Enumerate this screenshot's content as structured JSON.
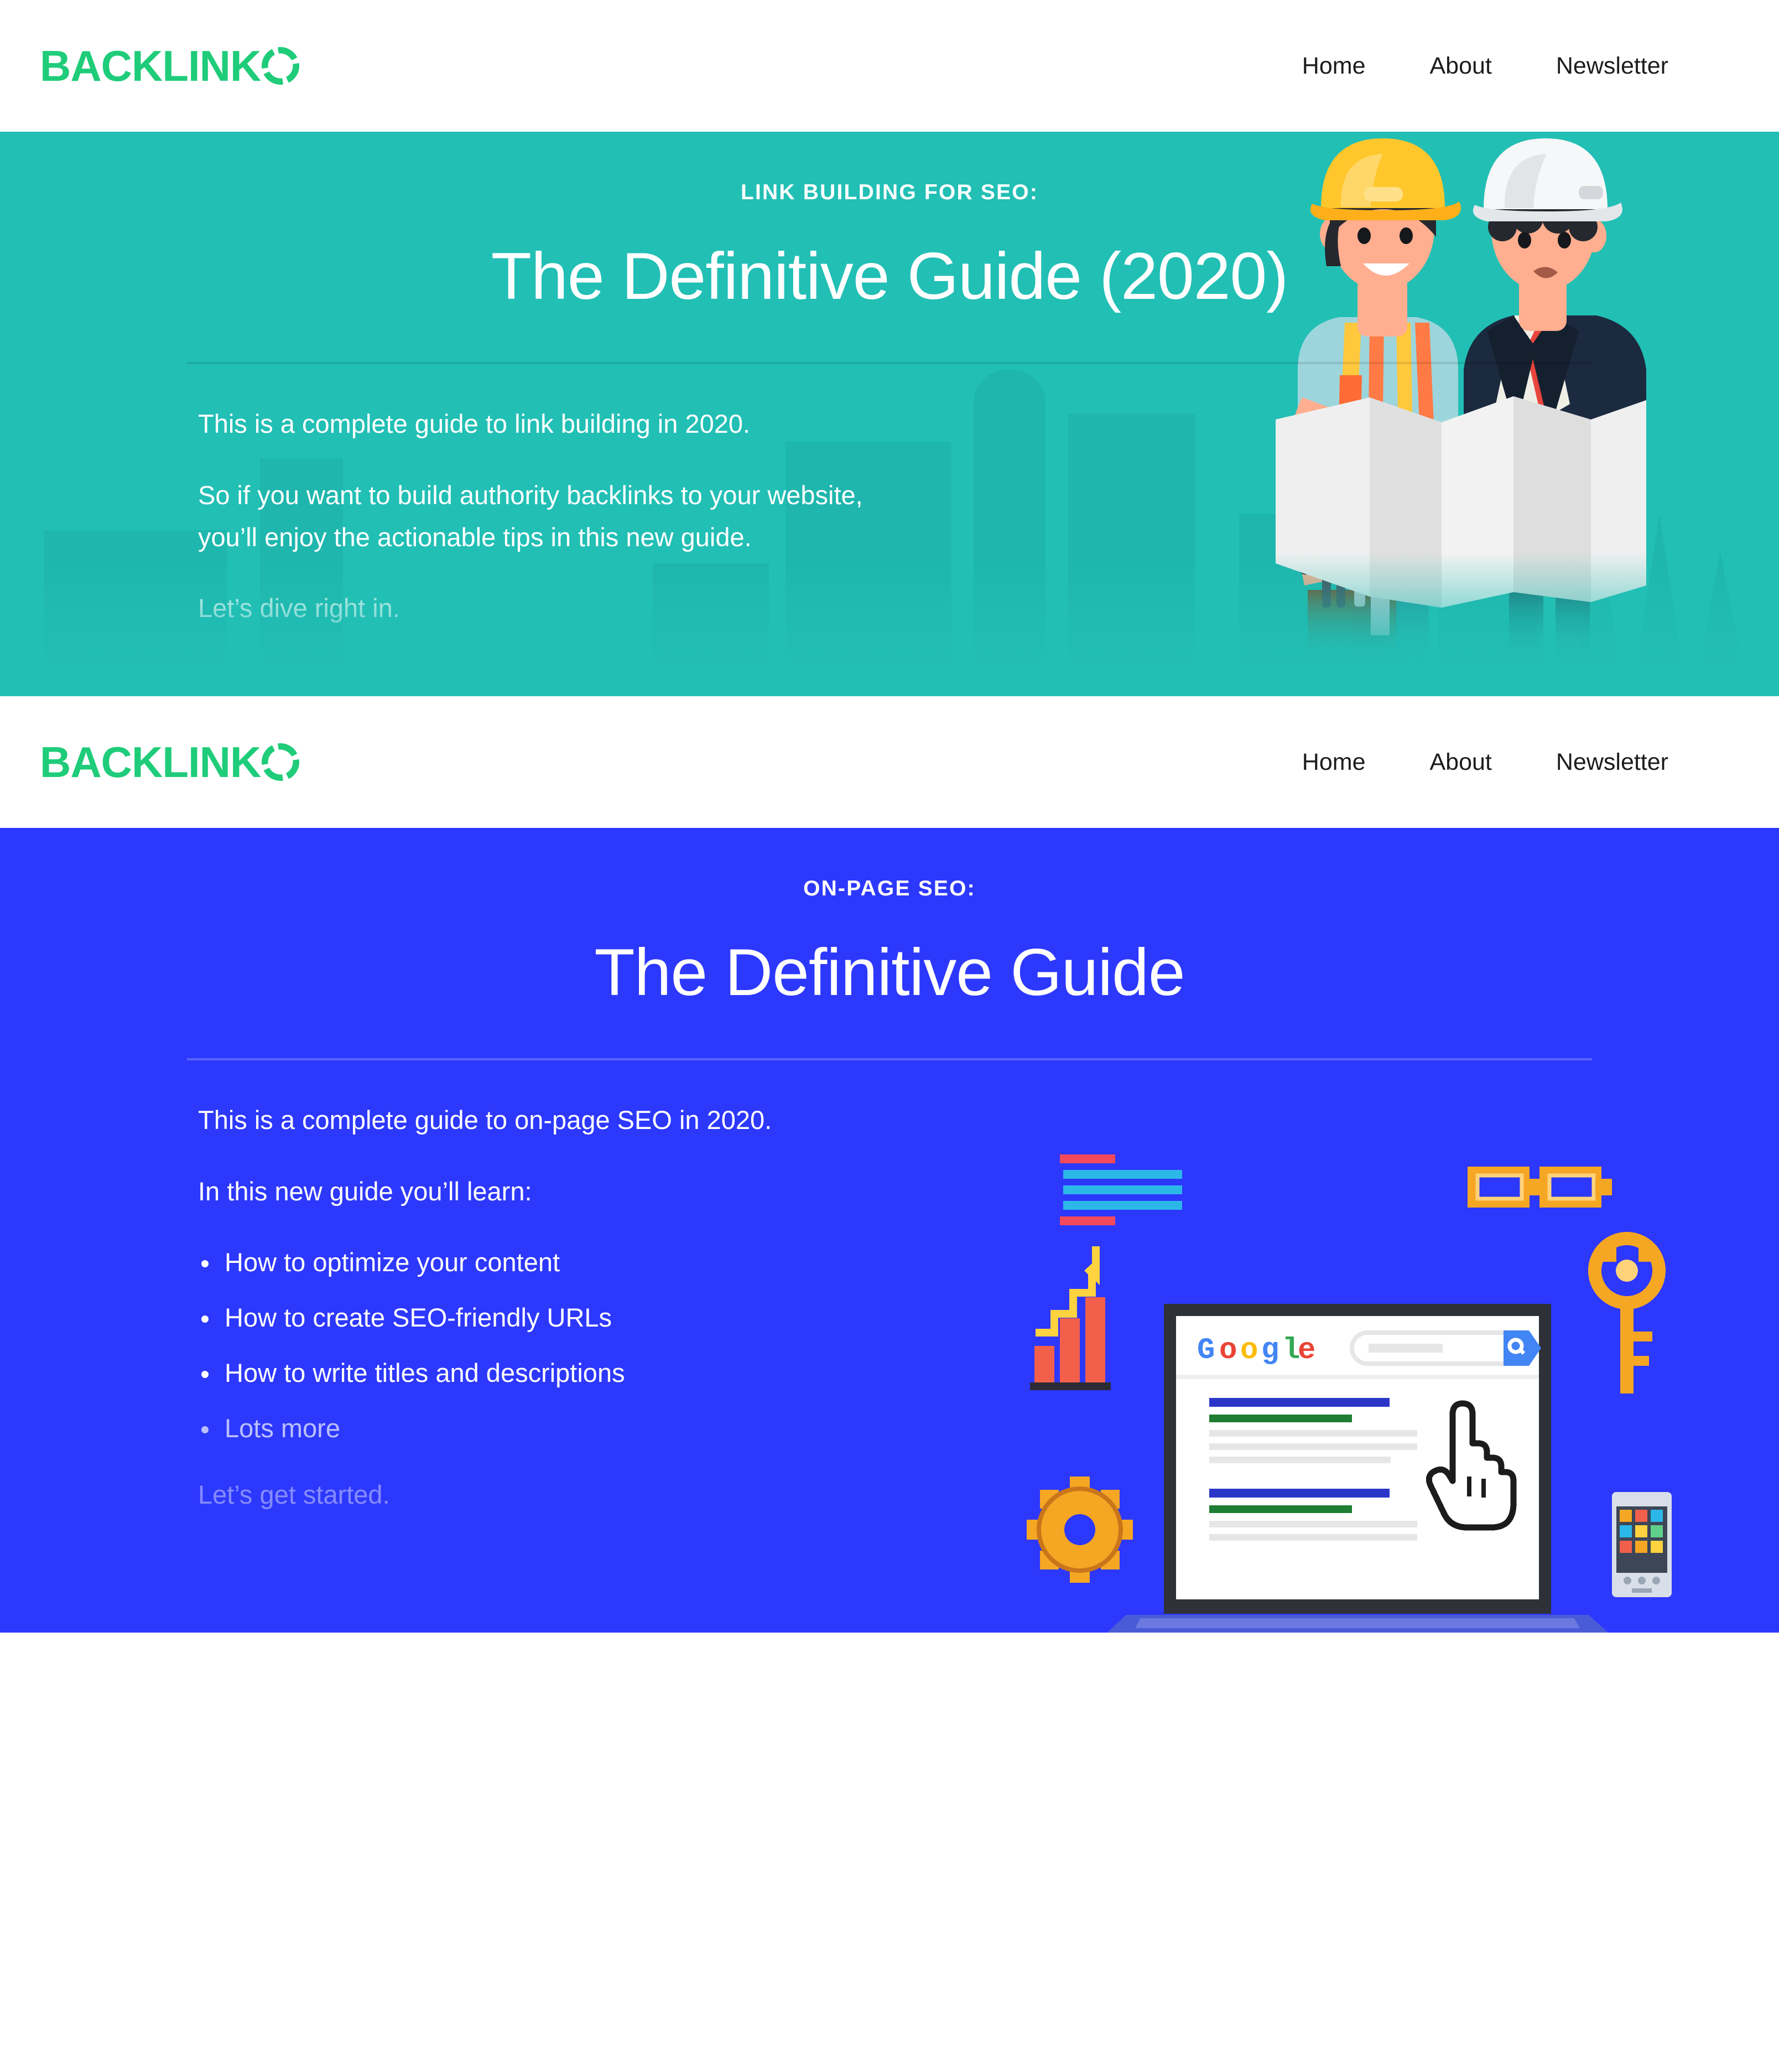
{
  "brand": {
    "logo_text": "BACKLINK",
    "logo_mark_icon": "segmented-circle-o-icon",
    "logo_color": "#1FCC79"
  },
  "nav": {
    "items": [
      {
        "label": "Home"
      },
      {
        "label": "About"
      },
      {
        "label": "Newsletter"
      }
    ]
  },
  "heroes": [
    {
      "id": "link-building",
      "background_color": "#22BFB5",
      "eyebrow": "LINK BUILDING FOR SEO:",
      "title": "The Definitive Guide (2020)",
      "paragraphs": [
        "This is a complete guide to link building in 2020.",
        "So if you want to build authority backlinks to your website, you’ll enjoy the actionable tips in this new guide.",
        "Let’s dive right in."
      ],
      "illustration": "two-construction-workers-with-blueprint-illustration"
    },
    {
      "id": "on-page-seo",
      "background_color": "#2D38FD",
      "eyebrow": "ON-PAGE SEO:",
      "title": "The Definitive Guide",
      "paragraphs": [
        "This is a complete guide to on-page SEO in 2020.",
        "In this new guide you’ll learn:"
      ],
      "bullets": [
        "How to optimize your content",
        "How to create SEO-friendly URLs",
        "How to write titles and descriptions",
        "Lots more"
      ],
      "closing": "Let’s get started.",
      "illustration": "pixel-art-laptop-google-search-illustration",
      "illustration_search_engine_label": "Google"
    }
  ]
}
